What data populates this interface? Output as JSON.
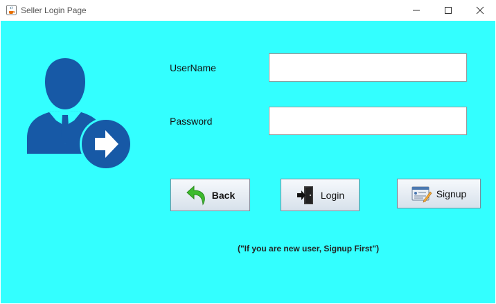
{
  "window": {
    "title": "Seller Login Page"
  },
  "form": {
    "username_label": "UserName",
    "username_value": "",
    "password_label": "Password",
    "password_value": ""
  },
  "buttons": {
    "back_label": "Back",
    "login_label": "Login",
    "signup_label": "Signup"
  },
  "note": "(\"If you are new user, Signup First\")",
  "icons": {
    "app": "java-coffee-icon",
    "logo": "user-login-icon",
    "back": "back-arrow-icon",
    "login": "door-enter-icon",
    "signup": "signup-form-icon"
  },
  "colors": {
    "background": "#33ffff",
    "logo": "#1759a6",
    "back_arrow": "#3dbb2e"
  }
}
